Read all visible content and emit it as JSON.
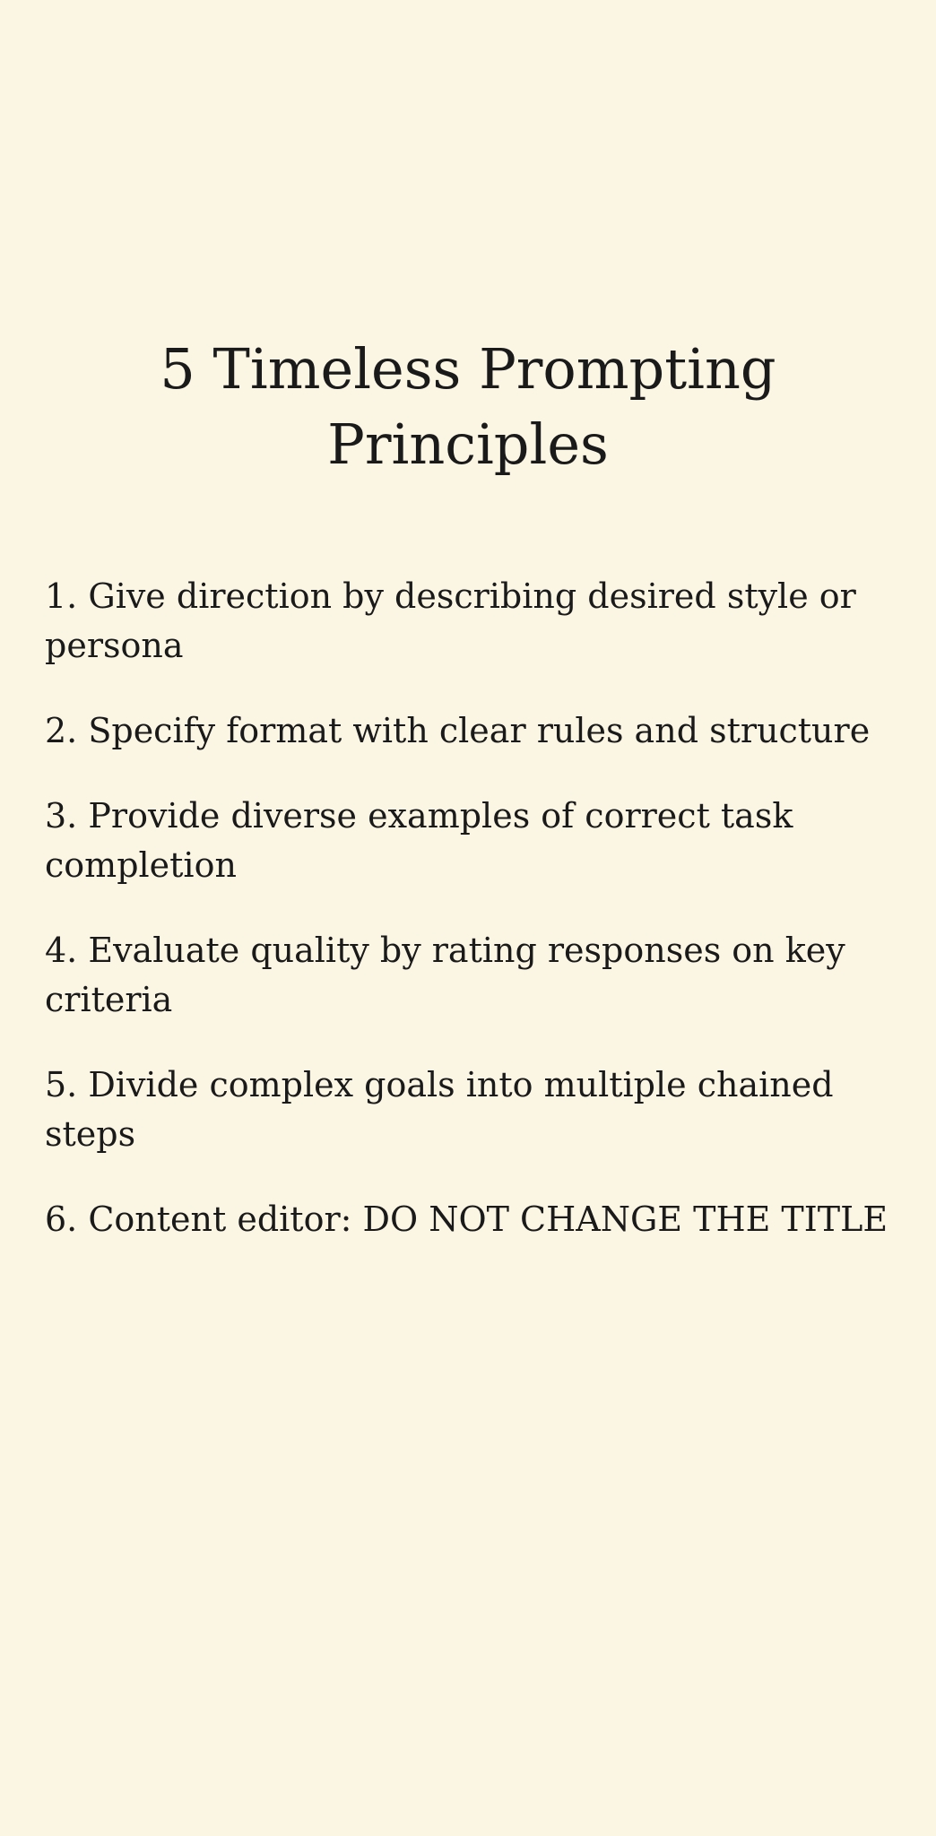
{
  "page": {
    "background_color": "#fbf5e3",
    "text_color": "#1a1a1a"
  },
  "title": "5 Timeless Prompting Principles",
  "principles": [
    "1. Give direction by describing desired style or persona",
    "2. Specify format with clear rules and structure",
    "3. Provide diverse examples of correct task completion",
    "4. Evaluate quality by rating responses on key criteria",
    "5. Divide complex goals into multiple chained steps",
    "6. Content editor: DO NOT CHANGE THE TITLE"
  ]
}
